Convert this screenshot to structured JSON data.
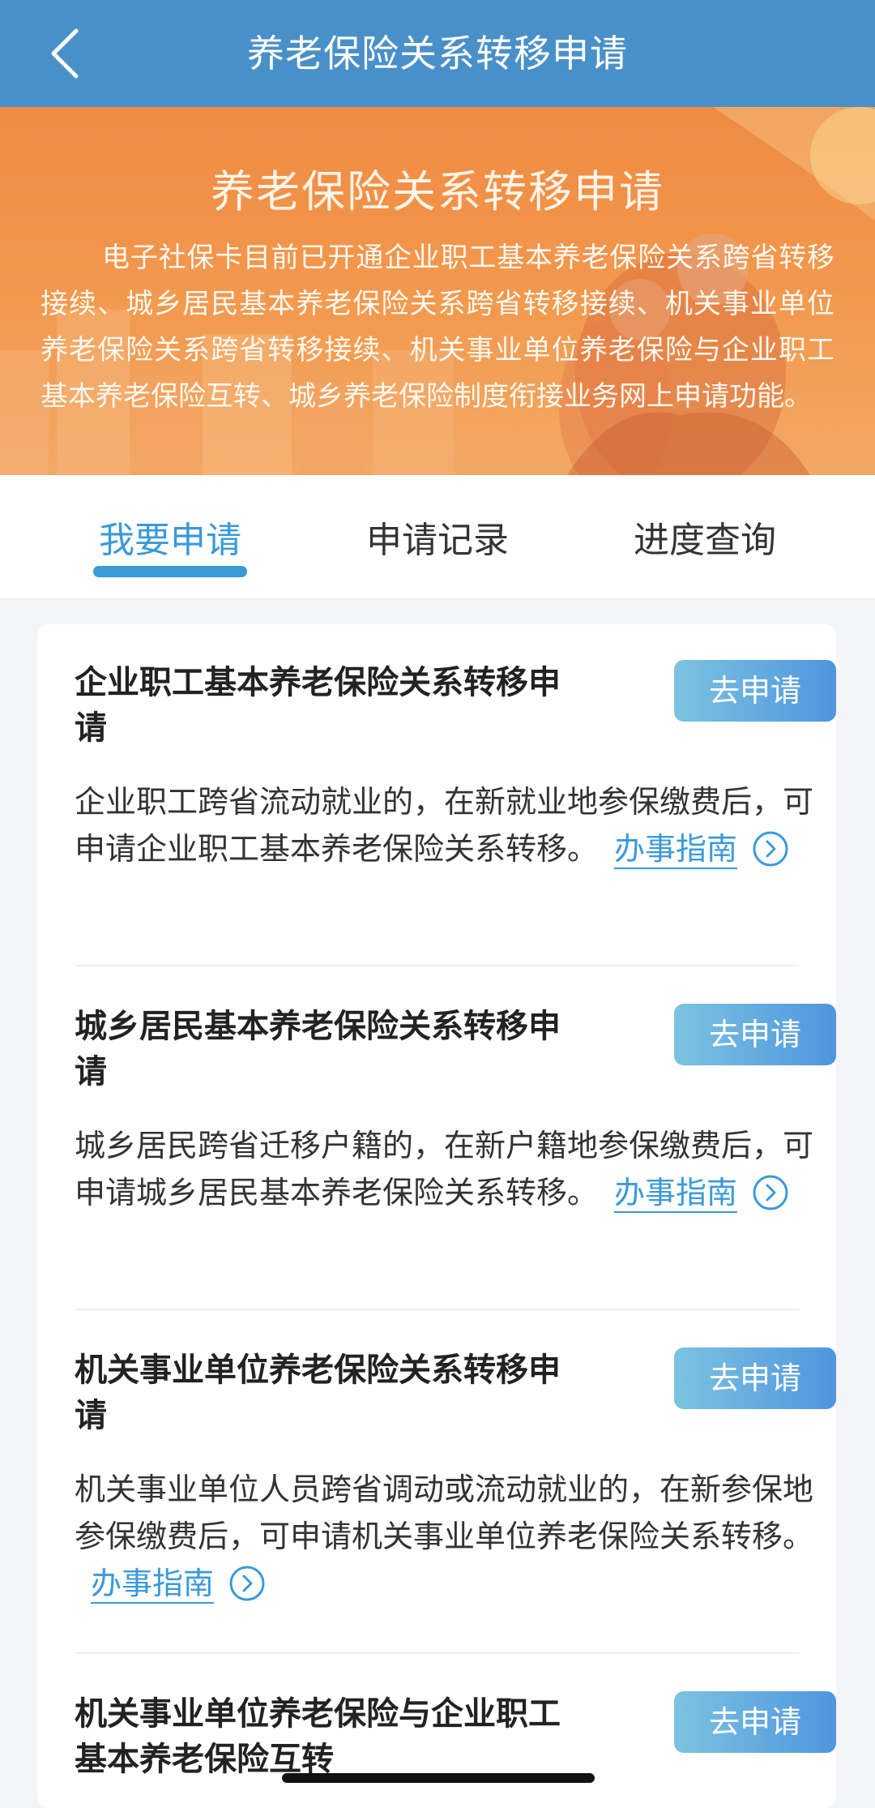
{
  "header": {
    "title": "养老保险关系转移申请",
    "back_icon": "chevron-left-icon"
  },
  "banner": {
    "title": "养老保险关系转移申请",
    "description": "电子社保卡目前已开通企业职工基本养老保险关系跨省转移接续、城乡居民基本养老保险关系跨省转移接续、机关事业单位养老保险关系跨省转移接续、机关事业单位养老保险与企业职工基本养老保险互转、城乡养老保险制度衔接业务网上申请功能。"
  },
  "tabs": [
    {
      "label": "我要申请",
      "active": true
    },
    {
      "label": "申请记录",
      "active": false
    },
    {
      "label": "进度查询",
      "active": false
    }
  ],
  "items": [
    {
      "title": "企业职工基本养老保险关系转移申请",
      "button": "去申请",
      "desc": "企业职工跨省流动就业的，在新就业地参保缴费后，可申请企业职工基本养老保险关系转移。",
      "guide": "办事指南"
    },
    {
      "title": "城乡居民基本养老保险关系转移申请",
      "button": "去申请",
      "desc": "城乡居民跨省迁移户籍的，在新户籍地参保缴费后，可申请城乡居民基本养老保险关系转移。",
      "guide": "办事指南"
    },
    {
      "title": "机关事业单位养老保险关系转移申请",
      "button": "去申请",
      "desc": "机关事业单位人员跨省调动或流动就业的，在新参保地参保缴费后，可申请机关事业单位养老保险关系转移。",
      "guide": "办事指南"
    },
    {
      "title": "机关事业单位养老保险与企业职工基本养老保险互转",
      "button": "去申请"
    }
  ],
  "colors": {
    "navbar": "#4a90c8",
    "accent": "#3a9ad8",
    "banner": "#f08a43"
  }
}
